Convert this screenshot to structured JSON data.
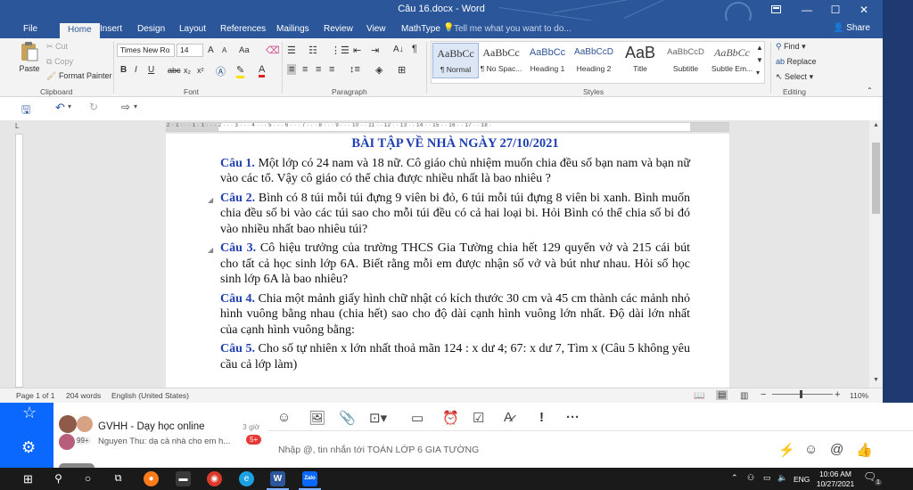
{
  "titlebar": {
    "doc_title": "Câu 16.docx - Word",
    "restore_icon": "ribbon-display-icon",
    "min": "—",
    "max": "☐",
    "close": "✕"
  },
  "tabs": [
    "File",
    "Home",
    "Insert",
    "Design",
    "Layout",
    "References",
    "Mailings",
    "Review",
    "View",
    "MathType"
  ],
  "tell_me": "Tell me what you want to do...",
  "share": "Share",
  "ribbon": {
    "clipboard": {
      "paste": "Paste",
      "cut": "Cut",
      "copy": "Copy",
      "format_painter": "Format Painter",
      "label": "Clipboard"
    },
    "font": {
      "name": "Times New Ro",
      "size": "14",
      "label": "Font",
      "aa": "Aa",
      "grow": "A",
      "shrink": "A",
      "bold": "B",
      "italic": "I",
      "underline": "U",
      "strike": "abc",
      "sub": "x₂",
      "sup": "x²"
    },
    "paragraph": {
      "label": "Paragraph",
      "pilcrow": "¶"
    },
    "styles": {
      "label": "Styles",
      "items": [
        {
          "sample": "AaBbCc",
          "name": "¶ Normal"
        },
        {
          "sample": "AaBbCc",
          "name": "¶ No Spac..."
        },
        {
          "sample": "AaBbCc",
          "name": "Heading 1"
        },
        {
          "sample": "AaBbCcD",
          "name": "Heading 2"
        },
        {
          "sample": "AaB",
          "name": "Title"
        },
        {
          "sample": "AaBbCcD",
          "name": "Subtitle"
        },
        {
          "sample": "AaBbCc",
          "name": "Subtle Em..."
        }
      ]
    },
    "editing": {
      "find": "Find",
      "replace": "Replace",
      "select": "Select",
      "label": "Editing"
    }
  },
  "ruler_numbers": "2 · 1 · · · 1 · 1 · · · 2 · · · 3 · · · 4 · · · 5 · · · 6 · · · 7 · · · 8 · · · 9 · · · 10 · · 11 · · 12 · · 13 · · 14 · · 15 · · 16 · · 17 · · 18 ·",
  "document": {
    "title": "BÀI TẬP VỀ NHÀ NGÀY 27/10/2021",
    "questions": [
      {
        "label": "Câu 1.",
        "text": " Một lớp có 24 nam và 18 nữ. Cô giáo chủ nhiệm muốn chia đều số bạn nam và bạn nữ vào các tổ. Vậy cô giáo có thể chia được nhiều nhất là bao nhiêu ?"
      },
      {
        "label": "Câu 2.",
        "text": " Bình có 8 túi mỗi túi đựng 9 viên bi đỏ, 6 túi mỗi túi đựng 8 viên bi xanh. Bình muốn chia đều số bi vào các túi sao cho mỗi túi đều có cả hai loại bi. Hỏi Bình có thể chia số bi đó vào nhiều nhất bao nhiêu túi?"
      },
      {
        "label": "Câu 3.",
        "text": " Cô hiệu trưởng của trường THCS Gia Tường chia hết 129 quyển vở và 215 cái bút cho tất cả học sinh lớp 6A. Biết rằng mỗi em được nhận số vở và bút như nhau. Hỏi số học sinh lớp 6A là bao nhiêu?"
      },
      {
        "label": "Câu 4.",
        "text": "  Chia một mảnh giấy hình chữ nhật có kích thước 30 cm và 45 cm thành các mảnh nhỏ hình vuông bằng nhau (chia hết) sao cho độ dài cạnh hình vuông lớn nhất. Độ dài lớn nhất của cạnh hình vuông bằng:"
      },
      {
        "label": "Câu 5.",
        "text": " Cho số tự nhiên x lớn nhất thoả mãn 124 : x dư 4;  67: x dư 7,  Tìm x (Câu 5 không yêu cầu cả lớp làm)"
      }
    ]
  },
  "status": {
    "page": "Page 1 of 1",
    "words": "204 words",
    "language": "English (United States)",
    "zoom_minus": "−",
    "zoom_plus": "+",
    "zoom": "110%"
  },
  "zalo": {
    "chat_name": "GVHH - Dạy học online",
    "chat_time": "3 giờ",
    "chat_preview": "Nguyen Thu: dạ cả nhà cho em h...",
    "member_badge": "99+",
    "unread_badge": "5+",
    "message_placeholder": "Nhập @, tin nhắn tới TOÁN LỚP 6 GIA TƯỜNG"
  },
  "taskbar": {
    "word_label": "W",
    "zalo_label": "Zalo",
    "language": "ENG",
    "time": "10:06 AM",
    "date": "10/27/2021",
    "notification_count": "1"
  },
  "colors": {
    "word_blue": "#2b579a",
    "heading_blue": "#1f3fb0",
    "zalo_blue": "#0a68ff"
  }
}
